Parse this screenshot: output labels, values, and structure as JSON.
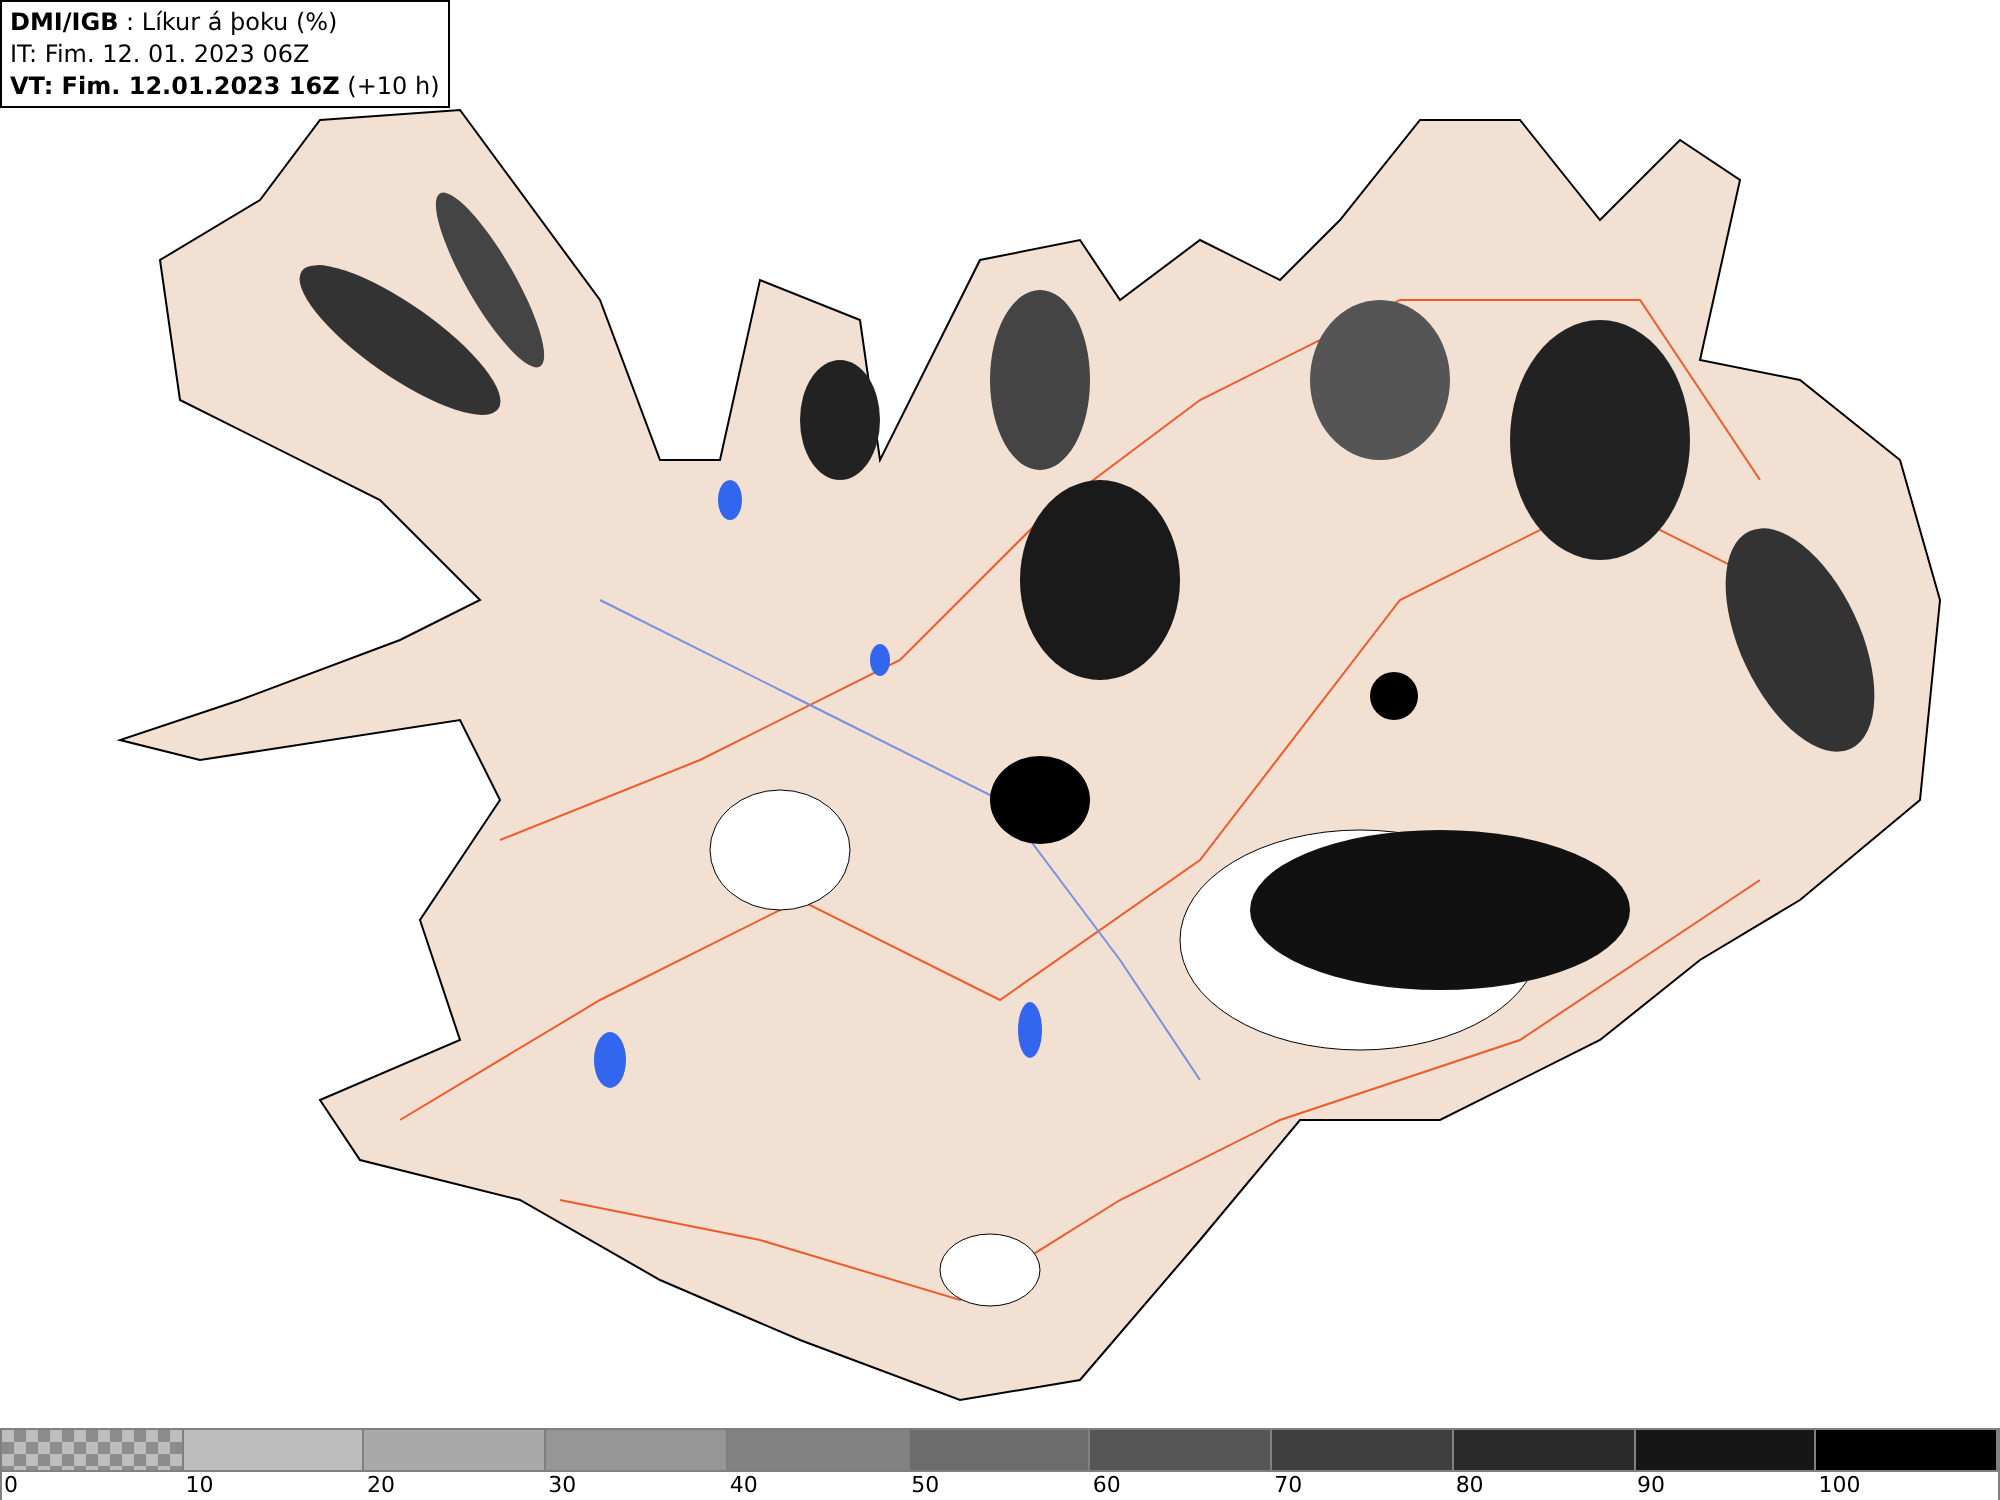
{
  "legend": {
    "lines": [
      "**DMI/IGB** : Líkur á þoku (%)",
      "IT: Fim. 12. 01. 2023 06Z",
      "**VT: Fim. 12.01.2023 16Z** (+10 h)"
    ]
  },
  "colorbar": [
    {
      "label": "0",
      "kind": "checker",
      "color": "#8c8c8c"
    },
    {
      "label": "10",
      "kind": "solid",
      "color": "#bdbdbd"
    },
    {
      "label": "20",
      "kind": "solid",
      "color": "#a9a9a9"
    },
    {
      "label": "30",
      "kind": "solid",
      "color": "#969696"
    },
    {
      "label": "40",
      "kind": "solid",
      "color": "#828282"
    },
    {
      "label": "50",
      "kind": "solid",
      "color": "#6c6c6c"
    },
    {
      "label": "60",
      "kind": "solid",
      "color": "#565656"
    },
    {
      "label": "70",
      "kind": "solid",
      "color": "#3f3f3f"
    },
    {
      "label": "80",
      "kind": "solid",
      "color": "#2a2a2a"
    },
    {
      "label": "90",
      "kind": "solid",
      "color": "#161616"
    },
    {
      "label": "100",
      "kind": "solid",
      "color": "#000000"
    }
  ]
}
